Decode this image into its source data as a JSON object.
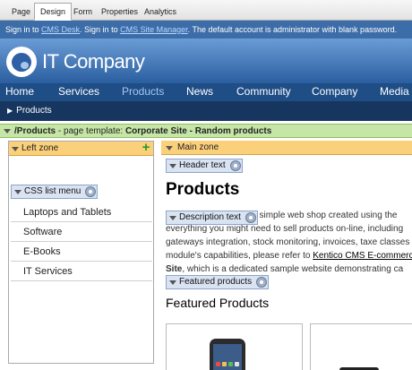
{
  "tabs": [
    {
      "label": "Page",
      "active": false
    },
    {
      "label": "Design",
      "active": true
    },
    {
      "label": "Form",
      "active": false
    },
    {
      "label": "Properties",
      "active": false
    },
    {
      "label": "Analytics",
      "active": false
    }
  ],
  "infobar": {
    "part1": "Sign in to ",
    "link1": "CMS Desk",
    "part2": ". Sign in to ",
    "link2": "CMS Site Manager",
    "part3": ". The default account is administrator with blank password."
  },
  "header": {
    "logo_text": "IT Company"
  },
  "nav": {
    "items": [
      {
        "label": "Home",
        "active": false
      },
      {
        "label": "Services",
        "active": false
      },
      {
        "label": "Products",
        "active": true
      },
      {
        "label": "News",
        "active": false
      },
      {
        "label": "Community",
        "active": false
      },
      {
        "label": "Company",
        "active": false
      },
      {
        "label": "Media",
        "active": false
      }
    ]
  },
  "breadcrumb": {
    "arrow": "▶",
    "label": "Products"
  },
  "template_bar": {
    "path": "/Products",
    "middle": " - page template: ",
    "template_name": "Corporate Site - Random products"
  },
  "left_zone": {
    "title": "Left zone",
    "webpart": "CSS list menu",
    "items": [
      "Laptops and Tablets",
      "Software",
      "E-Books",
      "IT Services"
    ]
  },
  "main_zone": {
    "title": "Main zone",
    "webpart_header": "Header text",
    "page_title": "Products",
    "webpart_description": "Description text",
    "desc_line1": "This section contains a simple web shop created using the",
    "desc_line2": "everything you might need to sell products on-line, including",
    "desc_line3": "gateways integration, stock monitoring, invoices, taxe classes",
    "desc_line4_pre": "module's capabilities, please refer to ",
    "desc_link": "Kentico CMS E-commerce",
    "desc_line5_bold": "Site",
    "desc_line5_rest": ", which is a dedicated sample website demonstrating ca",
    "webpart_featured": "Featured products",
    "featured_title": "Featured Products"
  },
  "colors": {
    "infobar": "#3d6da8",
    "nav": "#1f4d86",
    "breadcrumb": "#17365f",
    "template_bar": "#c5e6a6",
    "zone_header": "#fbd07a",
    "webpart": "#d9e3f2"
  },
  "icons": {
    "zone_toggle": "triangle-down-icon",
    "webpart_config": "gear-icon",
    "add_webpart": "plus-icon",
    "logo": "company-logo-icon"
  }
}
